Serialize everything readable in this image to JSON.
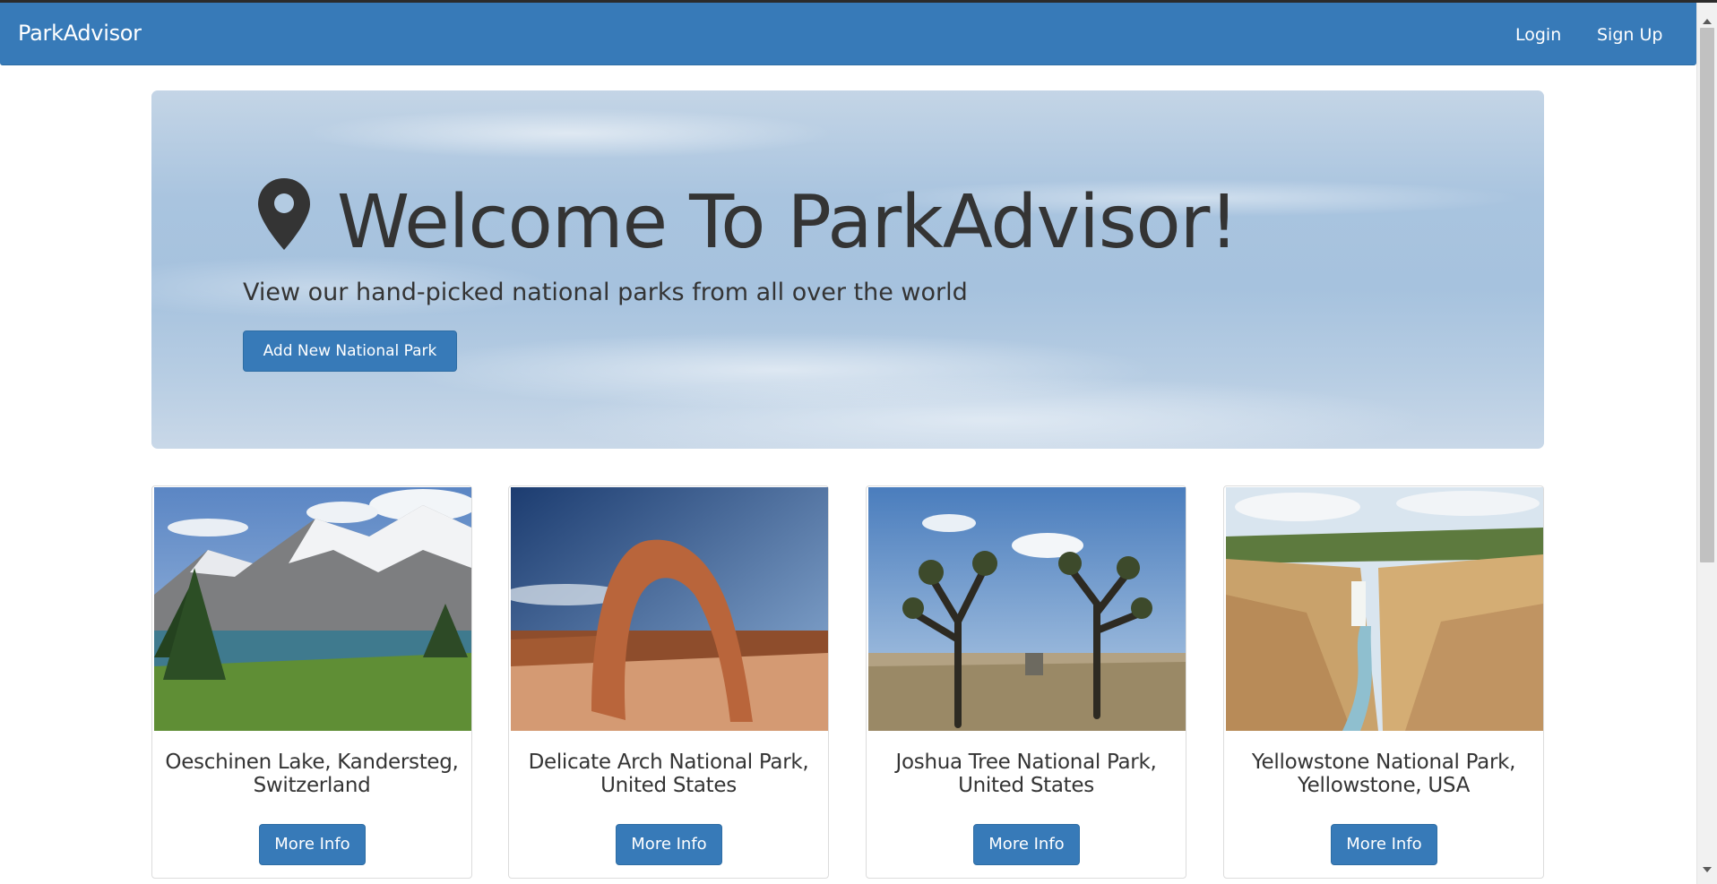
{
  "navbar": {
    "brand": "ParkAdvisor",
    "login": "Login",
    "signup": "Sign Up"
  },
  "hero": {
    "title": "Welcome To ParkAdvisor!",
    "subtitle": "View our hand-picked national parks from all over the world",
    "add_button": "Add New National Park",
    "icon": "map-marker-icon"
  },
  "parks": [
    {
      "line1": "Oeschinen Lake, Kandersteg,",
      "line2": "Switzerland",
      "button": "More Info"
    },
    {
      "line1": "Delicate Arch National Park,",
      "line2": "United States",
      "button": "More Info"
    },
    {
      "line1": "Joshua Tree National Park,",
      "line2": "United States",
      "button": "More Info"
    },
    {
      "line1": "Yellowstone National Park,",
      "line2": "Yellowstone, USA",
      "button": "More Info"
    }
  ],
  "colors": {
    "primary": "#377ab8",
    "primary_border": "#2e6da4",
    "text": "#343434"
  }
}
